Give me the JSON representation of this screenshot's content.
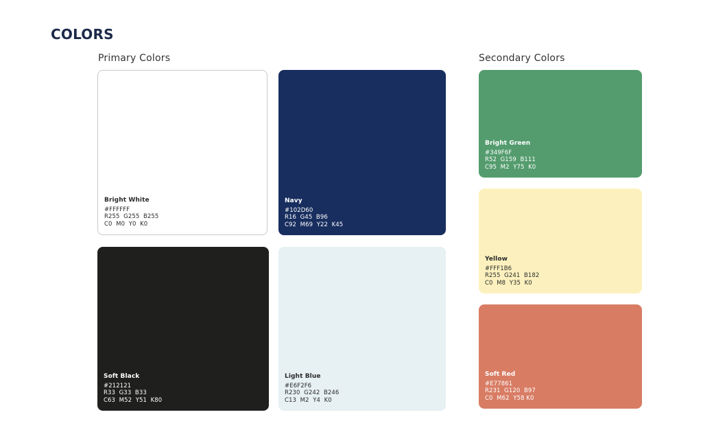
{
  "page": {
    "title": "COLORS"
  },
  "sections": {
    "primary_title": "Primary Colors",
    "secondary_title": "Secondary Colors"
  },
  "swatches": {
    "bright_white": {
      "name": "Bright White",
      "hex": "#FFFFFF",
      "rgb": "R255  G255  B255",
      "cmyk": "C0  M0  Y0  K0",
      "color": "#FFFFFF",
      "text_color": "#2a2a2a"
    },
    "navy": {
      "name": "Navy",
      "hex": "#102D60",
      "rgb": "R16  G45  B96",
      "cmyk": "C92  M69  Y22  K45",
      "color": "#182E5F",
      "text_color": "#FFFFFF"
    },
    "soft_black": {
      "name": "Soft Black",
      "hex": "#212121",
      "rgb": "R33  G33  B33",
      "cmyk": "C63  M52  Y51  K80",
      "color": "#1F201E",
      "text_color": "#FFFFFF"
    },
    "light_blue": {
      "name": "Light Blue",
      "hex": "#E6F2F6",
      "rgb": "R230  G242  B246",
      "cmyk": "C13  M2  Y4  K0",
      "color": "#E7F0F3",
      "text_color": "#2a2a2a"
    },
    "bright_green": {
      "name": "Bright Green",
      "hex": "#349F6F",
      "rgb": "R52  G159  B111",
      "cmyk": "C95  M2  Y75  K0",
      "color": "#549C6E",
      "text_color": "#FFFFFF"
    },
    "yellow": {
      "name": "Yellow",
      "hex": "#FFF1B6",
      "rgb": "R255  G241  B182",
      "cmyk": "C0  M8  Y35  K0",
      "color": "#FCF1BE",
      "text_color": "#2a2a2a"
    },
    "soft_red": {
      "name": "Soft Red",
      "hex": "#E77861",
      "rgb": "R231  G120  B97",
      "cmyk": "C0  M62  Y58 K0",
      "color": "#D87C64",
      "text_color": "#FFFFFF"
    }
  }
}
